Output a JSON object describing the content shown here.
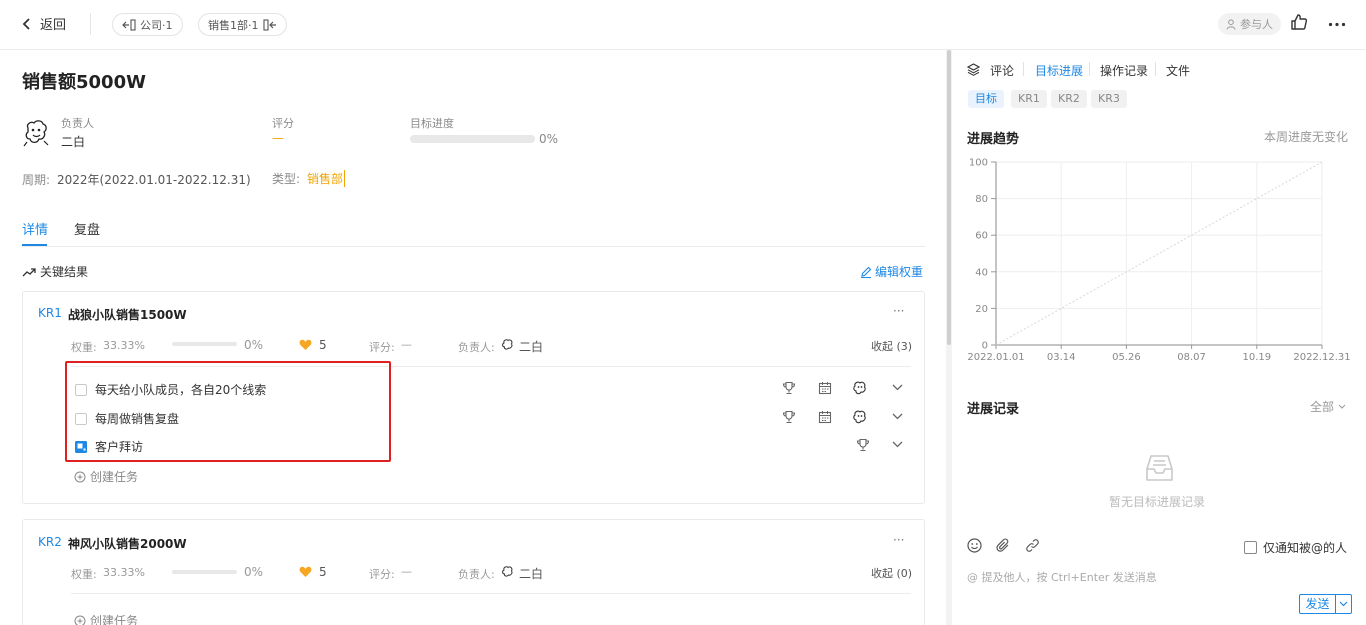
{
  "topbar": {
    "back_label": "返回",
    "crumbs": [
      "公司·1",
      "销售1部·1"
    ],
    "participant_label": "参与人"
  },
  "objective": {
    "title": "销售额5000W",
    "owner_label": "负责人",
    "owner_name": "二白",
    "score_label": "评分",
    "score_value": "—",
    "progress_label": "目标进度",
    "progress_value": "0%",
    "period_label": "周期:",
    "period_value": "2022年(2022.01.01-2022.12.31)",
    "type_label": "类型:",
    "type_value": "销售部"
  },
  "tabs": [
    "详情",
    "复盘"
  ],
  "key_results": {
    "header": "关键结果",
    "edit_weight": "编辑权重",
    "items": [
      {
        "tag": "KR1",
        "title": "战狼小队销售1500W",
        "weight_label": "权重:",
        "weight_value": "33.33%",
        "progress": "0%",
        "likes": "5",
        "score_label": "评分:",
        "score_value": "—",
        "owner_label": "负责人:",
        "owner_name": "二白",
        "collapse": "收起 (3)",
        "more": "···",
        "tasks": [
          "每天给小队成员，各自20个线索",
          "每周做销售复盘",
          "客户拜访"
        ],
        "create": "创建任务"
      },
      {
        "tag": "KR2",
        "title": "神风小队销售2000W",
        "weight_label": "权重:",
        "weight_value": "33.33%",
        "progress": "0%",
        "likes": "5",
        "score_label": "评分:",
        "score_value": "—",
        "owner_label": "负责人:",
        "owner_name": "二白",
        "collapse": "收起 (0)",
        "more": "···",
        "tasks": [],
        "create": "创建任务"
      }
    ]
  },
  "right_panel": {
    "tabs": [
      "评论",
      "目标进展",
      "操作记录",
      "文件"
    ],
    "chips": [
      "目标",
      "KR1",
      "KR2",
      "KR3"
    ],
    "trend_title": "进展趋势",
    "trend_status": "本周进度无变化",
    "records_title": "进展记录",
    "records_filter": "全部",
    "empty_text": "暂无目标进展记录",
    "notify_label": "仅通知被@的人",
    "input_placeholder": "@ 提及他人，按 Ctrl+Enter 发送消息",
    "send_label": "发送"
  },
  "chart_data": {
    "type": "line",
    "title": "进展趋势",
    "x_ticks": [
      "2022.01.01",
      "03.14",
      "05.26",
      "08.07",
      "10.19",
      "2022.12.31"
    ],
    "y_ticks": [
      0,
      20,
      40,
      60,
      80,
      100
    ],
    "ylim": [
      0,
      100
    ],
    "series": [
      {
        "values": [
          0,
          100
        ],
        "x": [
          "2022.01.01",
          "2022.12.31"
        ],
        "style": "dashed"
      }
    ],
    "grid": true,
    "colors": {
      "guide": "#d8d8d8",
      "grid": "#eeeeee"
    }
  },
  "colors": {
    "accent": "#1e88e5",
    "type_tag": "#f0a500",
    "like": "#f5a623",
    "highlight_box": "#e02020"
  }
}
